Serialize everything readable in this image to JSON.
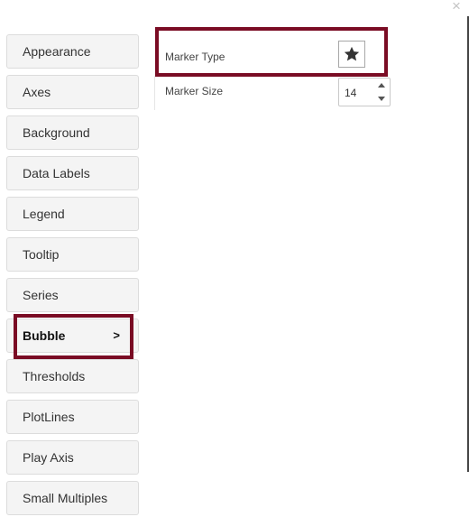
{
  "window": {
    "close_glyph": "×"
  },
  "sidebar": {
    "items": [
      {
        "label": "Appearance"
      },
      {
        "label": "Axes"
      },
      {
        "label": "Background"
      },
      {
        "label": "Data Labels"
      },
      {
        "label": "Legend"
      },
      {
        "label": "Tooltip"
      },
      {
        "label": "Series"
      },
      {
        "label": "Bubble",
        "active": true,
        "arrow": ">"
      },
      {
        "label": "Thresholds"
      },
      {
        "label": "PlotLines"
      },
      {
        "label": "Play Axis"
      },
      {
        "label": "Small Multiples"
      }
    ]
  },
  "bubble_settings": {
    "marker_type": {
      "label": "Marker Type",
      "value_icon": "star-icon"
    },
    "marker_size": {
      "label": "Marker Size",
      "value": "14"
    }
  },
  "colors": {
    "highlight": "#7a0c24",
    "nav_bg": "#f4f4f4",
    "nav_border": "#dcdcdc"
  }
}
